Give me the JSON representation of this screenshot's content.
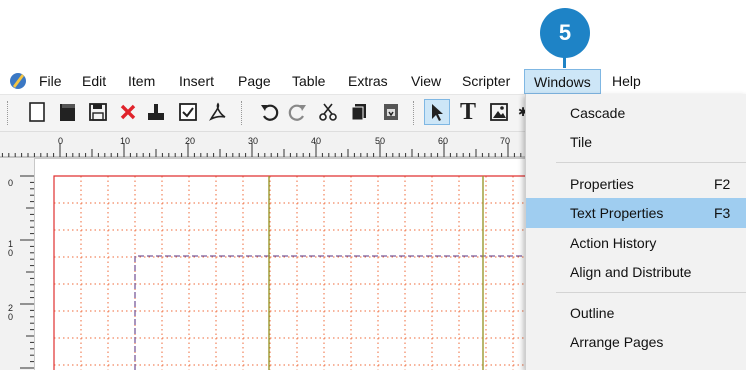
{
  "callout": {
    "step": "5"
  },
  "menubar": {
    "items": [
      "File",
      "Edit",
      "Item",
      "Insert",
      "Page",
      "Table",
      "Extras",
      "View",
      "Scripter",
      "Windows",
      "Help"
    ],
    "active": "Windows"
  },
  "toolbar": {
    "icons": [
      "new-document-icon",
      "open-icon",
      "save-icon",
      "close-icon",
      "print-icon",
      "preflight-check-icon",
      "export-pdf-icon",
      "undo-icon",
      "redo-icon",
      "cut-icon",
      "copy-icon",
      "paste-icon",
      "select-tool-icon",
      "text-frame-icon",
      "image-frame-icon"
    ]
  },
  "ruler": {
    "horizontal_ticks": [
      "0",
      "10",
      "20",
      "30",
      "40",
      "50",
      "60",
      "70"
    ],
    "vertical_ticks": [
      "0",
      "1\n0",
      "2\n0"
    ]
  },
  "windows_menu": {
    "groups": [
      [
        {
          "label": "Cascade",
          "shortcut": ""
        },
        {
          "label": "Tile",
          "shortcut": ""
        }
      ],
      [
        {
          "label": "Properties",
          "shortcut": "F2"
        },
        {
          "label": "Text Properties",
          "shortcut": "F3",
          "highlighted": true
        },
        {
          "label": "Action History",
          "shortcut": ""
        },
        {
          "label": "Align and Distribute",
          "shortcut": ""
        }
      ],
      [
        {
          "label": "Outline",
          "shortcut": ""
        },
        {
          "label": "Arrange Pages",
          "shortcut": ""
        }
      ]
    ]
  },
  "colors": {
    "callout": "#1e83c6",
    "menu_highlight": "#9fcdf0",
    "page_border": "#e03030",
    "grid": "#ef6a3a",
    "guide": "#9a9a30",
    "margin_guide": "#7a5a9a"
  }
}
